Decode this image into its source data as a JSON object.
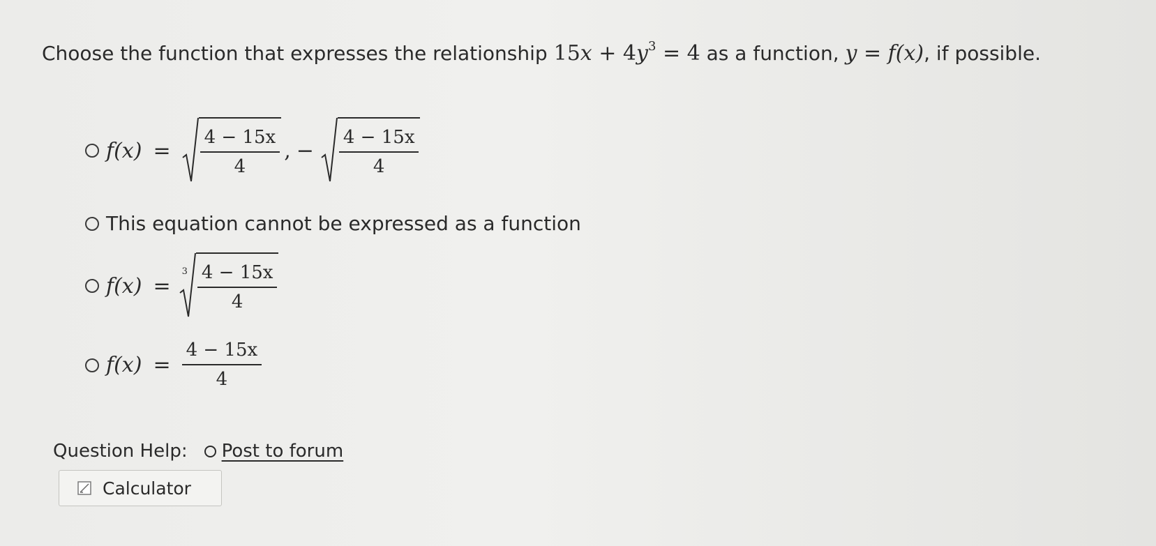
{
  "question": {
    "text_before": "Choose the function that expresses the relationship",
    "equation_lhs_a": "15",
    "equation_var_x": "x",
    "equation_plus": " + 4",
    "equation_var_y": "y",
    "equation_exp": "3",
    "equation_rhs": " = 4",
    "text_middle": "as a function,",
    "function_notation": "y = f(x)",
    "text_after": ", if possible."
  },
  "options": [
    {
      "lhs": "f(x)",
      "eq": "=",
      "numerator": "4 − 15x",
      "denominator": "4",
      "separator": ",",
      "negative": "−",
      "numerator_2": "4 − 15x",
      "denominator_2": "4"
    },
    {
      "text": "This equation cannot be expressed as a function"
    },
    {
      "lhs": "f(x)",
      "eq": "=",
      "root_index": "3",
      "numerator": "4 − 15x",
      "denominator": "4"
    },
    {
      "lhs": "f(x)",
      "eq": "=",
      "numerator": "4 − 15x",
      "denominator": "4"
    }
  ],
  "help": {
    "label": "Question Help:",
    "forum_link": "Post to forum",
    "forum_icon": "speech-bubble-icon"
  },
  "calculator": {
    "label": "Calculator",
    "icon": "calculator-icon"
  }
}
